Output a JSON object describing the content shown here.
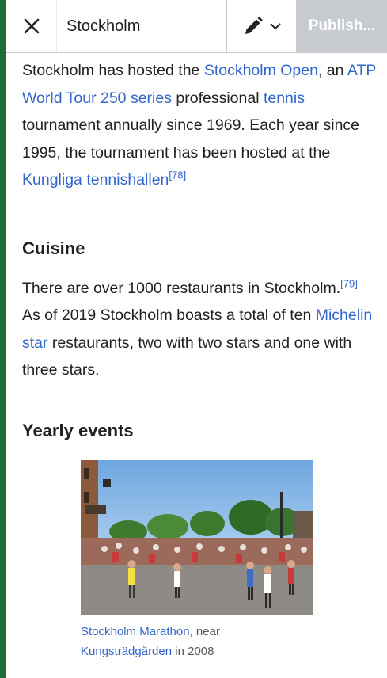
{
  "toolbar": {
    "close_icon": "close-icon",
    "title": "Stockholm",
    "edit_icon": "pencil-icon",
    "publish_label": "Publish..."
  },
  "article": {
    "p1": {
      "t1": "Stockholm has hosted the ",
      "l1": "Stockholm Open",
      "t2": ", an ",
      "l2": "ATP World Tour 250 series",
      "t3": " professional ",
      "l3": "tennis",
      "t4": " tournament annually since 1969. Each year since 1995, the tournament has been hosted at the ",
      "l4": "Kungliga tennishallen",
      "ref": "[78]"
    },
    "cuisine_heading": "Cuisine",
    "p2": {
      "t1": "There are over 1000 restaurants in Stockholm.",
      "ref": "[79]",
      "t2": " As of 2019 Stockholm boasts a total of ten ",
      "l1": "Michelin star",
      "t3": " restaurants, two with two stars and one with three stars."
    },
    "yearly_heading": "Yearly events",
    "figure": {
      "caption_link1": "Stockholm Marathon",
      "caption_t1": ", near ",
      "caption_link2": "Kungsträdgården",
      "caption_t2": " in 2008"
    }
  },
  "colors": {
    "link": "#3366cc",
    "text": "#202122",
    "publish_disabled": "#c8ccd1",
    "background_outer": "#1e6b3a"
  }
}
